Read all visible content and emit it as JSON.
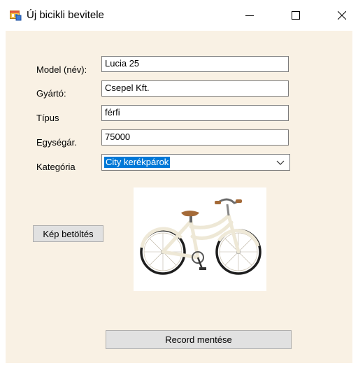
{
  "window": {
    "title": "Új bicikli bevitele",
    "icons": {
      "app": "form-icon",
      "minimize": "minimize-icon",
      "maximize": "maximize-icon",
      "close": "close-icon"
    }
  },
  "form": {
    "model_label": "Model (név):",
    "model_value": "Lucia 25",
    "manufacturer_label": "Gyártó:",
    "manufacturer_value": "Csepel Kft.",
    "type_label": "Típus",
    "type_value": "férfi",
    "unit_price_label": "Egységár.",
    "unit_price_value": "75000",
    "category_label": "Kategória",
    "category_value": "City kerékpárok"
  },
  "buttons": {
    "load_image": "Kép betöltés",
    "save_record": "Record mentése"
  },
  "image": {
    "subject": "bicycle-image"
  },
  "colors": {
    "client_background": "#f9f1e4",
    "selection": "#0078d7",
    "button_face": "#e1e1e1"
  }
}
